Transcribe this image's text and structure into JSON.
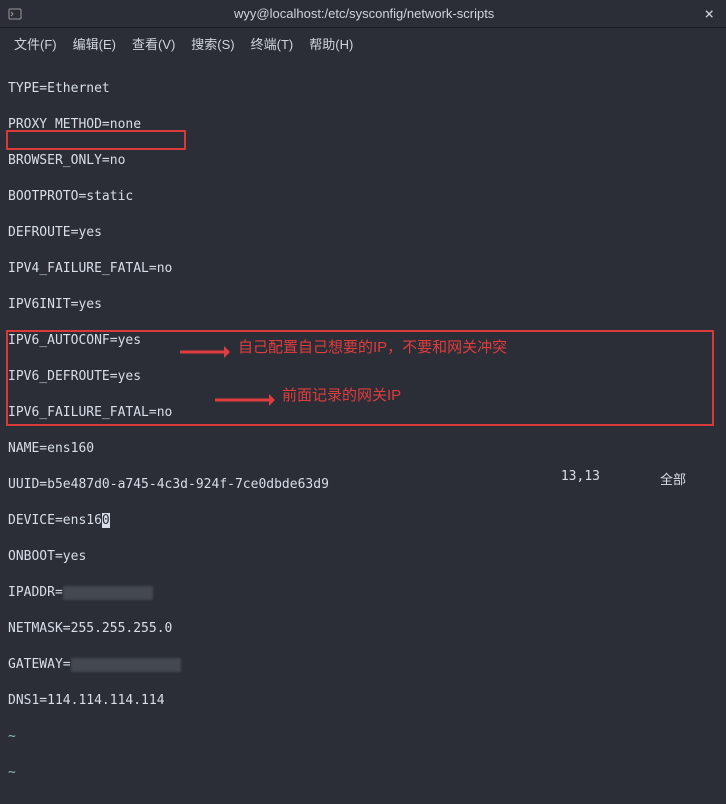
{
  "window": {
    "title": "wyy@localhost:/etc/sysconfig/network-scripts"
  },
  "menu": {
    "file": "文件(F)",
    "edit": "编辑(E)",
    "view": "查看(V)",
    "search": "搜索(S)",
    "terminal": "终端(T)",
    "help": "帮助(H)"
  },
  "content": {
    "l1": "TYPE=Ethernet",
    "l2": "PROXY_METHOD=none",
    "l3": "BROWSER_ONLY=no",
    "l4": "BOOTPROTO=static",
    "l5": "DEFROUTE=yes",
    "l6": "IPV4_FAILURE_FATAL=no",
    "l7": "IPV6INIT=yes",
    "l8": "IPV6_AUTOCONF=yes",
    "l9": "IPV6_DEFROUTE=yes",
    "l10": "IPV6_FAILURE_FATAL=no",
    "l11": "NAME=ens160",
    "l12": "UUID=b5e487d0-a745-4c3d-924f-7ce0dbde63d9",
    "l13a": "DEVICE=ens16",
    "l13b": "0",
    "l14": "ONBOOT=yes",
    "l15": "IPADDR=",
    "l16": "NETMASK=255.255.255.0",
    "l17": "GATEWAY=",
    "l18": "DNS1=114.114.114.114",
    "tilde": "~"
  },
  "annotations": {
    "a1": "自己配置自己想要的IP，不要和网关冲突",
    "a2": "前面记录的网关IP"
  },
  "status": {
    "pos": "13,13",
    "mode": "全部"
  }
}
